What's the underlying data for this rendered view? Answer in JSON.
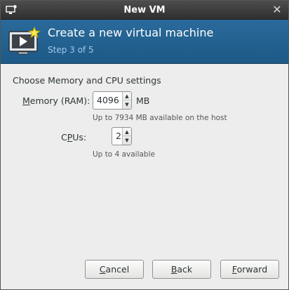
{
  "window": {
    "title": "New VM"
  },
  "header": {
    "heading": "Create a new virtual machine",
    "step": "Step 3 of 5"
  },
  "section_title": "Choose Memory and CPU settings",
  "memory": {
    "label_mnemonic": "M",
    "label_rest": "emory (RAM):",
    "value": "4096",
    "unit": "MB",
    "hint": "Up to 7934 MB available on the host"
  },
  "cpus": {
    "label_pre": "C",
    "label_mnemonic": "P",
    "label_post": "Us:",
    "value": "2",
    "hint": "Up to 4 available"
  },
  "buttons": {
    "cancel_mnemonic": "C",
    "cancel_rest": "ancel",
    "back_mnemonic": "B",
    "back_rest": "ack",
    "forward_mnemonic": "F",
    "forward_rest": "orward"
  },
  "icons": {
    "app": "vm-window-icon",
    "header": "computer-star-icon",
    "close": "close-icon",
    "up": "chevron-up-icon",
    "down": "chevron-down-icon"
  },
  "colors": {
    "titlebar": "#3a3a3a",
    "header": "#245f8f",
    "step_text": "#9ec9ec",
    "background": "#ededed"
  }
}
